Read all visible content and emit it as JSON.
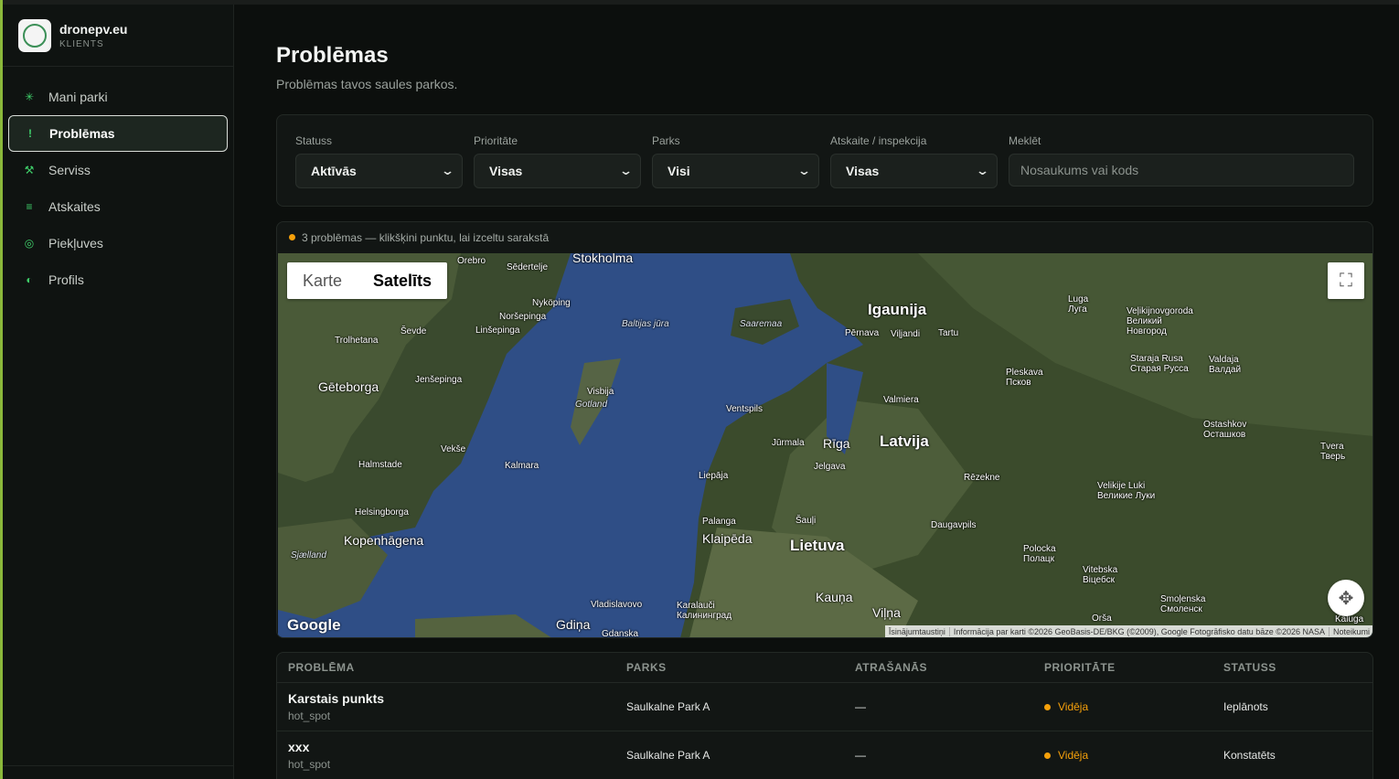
{
  "brand": {
    "name": "dronepv.eu",
    "role": "KLIENTS"
  },
  "nav": [
    {
      "label": "Mani parki",
      "icon": "sun-icon",
      "glyph": "✳"
    },
    {
      "label": "Problēmas",
      "icon": "alert-icon",
      "glyph": "!",
      "active": true
    },
    {
      "label": "Serviss",
      "icon": "tools-icon",
      "glyph": "⚒"
    },
    {
      "label": "Atskaites",
      "icon": "list-icon",
      "glyph": "≡"
    },
    {
      "label": "Piekļuves",
      "icon": "target-icon",
      "glyph": "◎"
    },
    {
      "label": "Profils",
      "icon": "contrast-icon",
      "glyph": "◐"
    }
  ],
  "page": {
    "title": "Problēmas",
    "subtitle": "Problēmas tavos saules parkos."
  },
  "filters": {
    "status": {
      "label": "Statuss",
      "value": "Aktīvās"
    },
    "priority": {
      "label": "Prioritāte",
      "value": "Visas"
    },
    "park": {
      "label": "Parks",
      "value": "Visi"
    },
    "report": {
      "label": "Atskaite / inspekcija",
      "value": "Visas"
    },
    "search": {
      "label": "Meklēt",
      "placeholder": "Nosaukums vai kods"
    }
  },
  "map": {
    "info": "3 problēmas — klikšķini punktu, lai izceltu sarakstā",
    "type_map": "Karte",
    "type_satellite": "Satelīts",
    "google": "Google",
    "attribution": [
      "Īsinājumtaustiņi",
      "Informācija par karti ©2026 GeoBasis-DE/BKG (©2009), Google Fotogrāfisko datu bāze ©2026 NASA",
      "Noteikumi"
    ],
    "labels": {
      "igaunija": "Igaunija",
      "latvija": "Latvija",
      "lietuva": "Lietuva",
      "riga": "Rīga",
      "klaipeda": "Klaipēda",
      "kauna": "Kauņa",
      "vilna": "Viļņa",
      "geteborga": "Gēteborga",
      "kopenhagena": "Kopenhāgena",
      "stokholma": "Stokholma",
      "baltijas": "Baltijas jūra",
      "saaremaa": "Saaremaa",
      "gotland": "Gotland",
      "visbija": "Visbija",
      "tartu": "Tartu",
      "parnava": "Pērnava",
      "viljandi": "Viļjandi",
      "ventspils": "Ventspils",
      "jurmala": "Jūrmala",
      "jelgava": "Jelgava",
      "liepaja": "Liepāja",
      "rezekne": "Rēzekne",
      "daugavpils": "Daugavpils",
      "valmiera": "Valmiera",
      "palanga": "Palanga",
      "sauli": "Šauļi",
      "pleskava": "Pleskava",
      "pskov": "Псков",
      "norsepinga": "Noršepinga",
      "linsepinga": "Linšepinga",
      "nykoping": "Nyköping",
      "jensepinga": "Jenšepinga",
      "kalmara": "Kalmara",
      "vekse": "Vekše",
      "halmstade": "Halmstade",
      "helsingborga": "Helsingborga",
      "trolhetana": "Trolhetana",
      "sevde": "Ševde",
      "orebro": "Orebro",
      "sedertelje": "Sēdertelje",
      "karalauci": "Karalauči",
      "kaliningrad": "Калининград",
      "gdina": "Gdiņa",
      "vladislavovo": "Vladislavovo",
      "gdanska": "Gdanska",
      "polocka": "Polocka",
      "polotsk": "Полацк",
      "vitebska": "Vitebska",
      "viciebsk": "Віцебск",
      "velikieluki": "Velikije Luki",
      "velikieluki_ru": "Великие Луки",
      "luga": "Luga",
      "luga_ru": "Луга",
      "novgorod": "Veļikijnovgoroda",
      "novgorod_ru1": "Великий",
      "novgorod_ru2": "Новгород",
      "staraya": "Staraja Rusa",
      "staraya_ru": "Старая Русса",
      "valdaja": "Valdaja",
      "valdai_ru": "Валдай",
      "ostashkov": "Ostashkov",
      "ostashkov_ru": "Осташков",
      "tvera": "Tvera",
      "tver_ru": "Тверь",
      "smolenska": "Smoļenska",
      "smolensk_ru": "Смоленск",
      "sjaelland": "Sjælland",
      "orsa": "Orša",
      "kaluga": "Kaluga"
    }
  },
  "table": {
    "headers": [
      "PROBLĒMA",
      "PARKS",
      "ATRAŠANĀS",
      "PRIORITĀTE",
      "STATUSS"
    ],
    "rows": [
      {
        "name": "Karstais punkts",
        "code": "hot_spot",
        "park": "Saulkalne Park A",
        "location": "—",
        "priority": "Vidēja",
        "status": "Ieplānots"
      },
      {
        "name": "xxx",
        "code": "hot_spot",
        "park": "Saulkalne Park A",
        "location": "—",
        "priority": "Vidēja",
        "status": "Konstatēts"
      }
    ]
  },
  "colors": {
    "accent": "#3fcf6a",
    "priority_medium": "#f5a00a",
    "background": "#0c0f0d"
  }
}
